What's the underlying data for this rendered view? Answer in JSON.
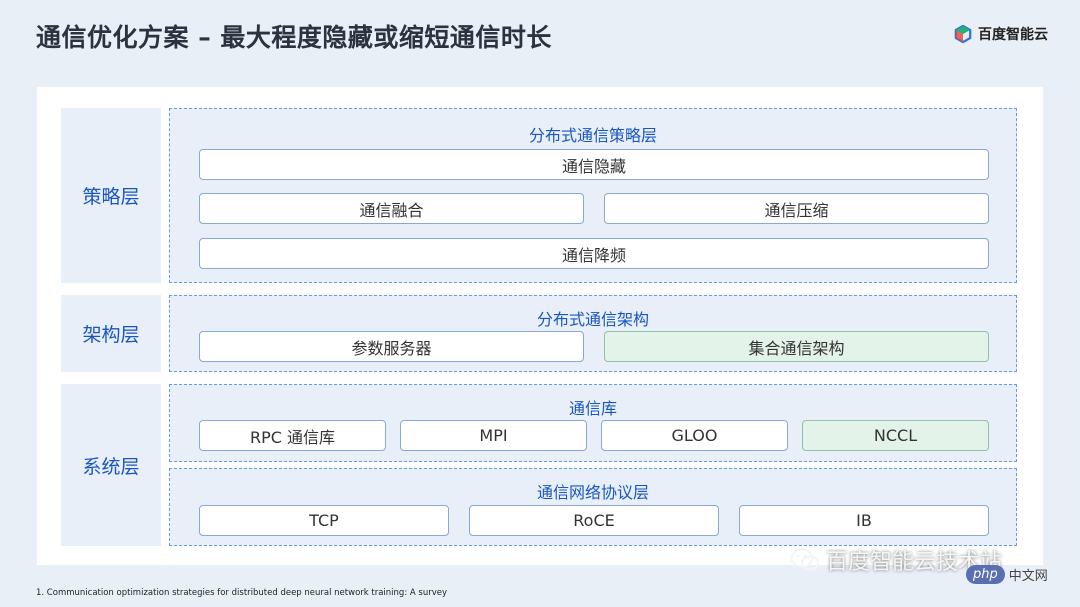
{
  "slide": {
    "title": "通信优化方案 – 最大程度隐藏或缩短通信时长",
    "brand": "百度智能云",
    "footnote": "1. Communication optimization strategies for distributed deep neural network training: A survey",
    "watermark": "百度智能云技术站",
    "php_label": "php",
    "php_suffix": "中文网"
  },
  "layers": {
    "strategy": {
      "label": "策略层",
      "group_title": "分布式通信策略层",
      "items": [
        "通信隐藏",
        "通信融合",
        "通信压缩",
        "通信降频"
      ]
    },
    "architecture": {
      "label": "架构层",
      "group_title": "分布式通信架构",
      "items": [
        "参数服务器",
        "集合通信架构"
      ]
    },
    "system": {
      "label": "系统层",
      "library": {
        "title": "通信库",
        "items": [
          "RPC 通信库",
          "MPI",
          "GLOO",
          "NCCL"
        ]
      },
      "protocol": {
        "title": "通信网络协议层",
        "items": [
          "TCP",
          "RoCE",
          "IB"
        ]
      }
    }
  },
  "colors": {
    "accent": "#1a56c2",
    "dashed_border": "#6a9be0",
    "layer_bg": "#e8eff8",
    "highlight_green": "#e4f3ea"
  }
}
